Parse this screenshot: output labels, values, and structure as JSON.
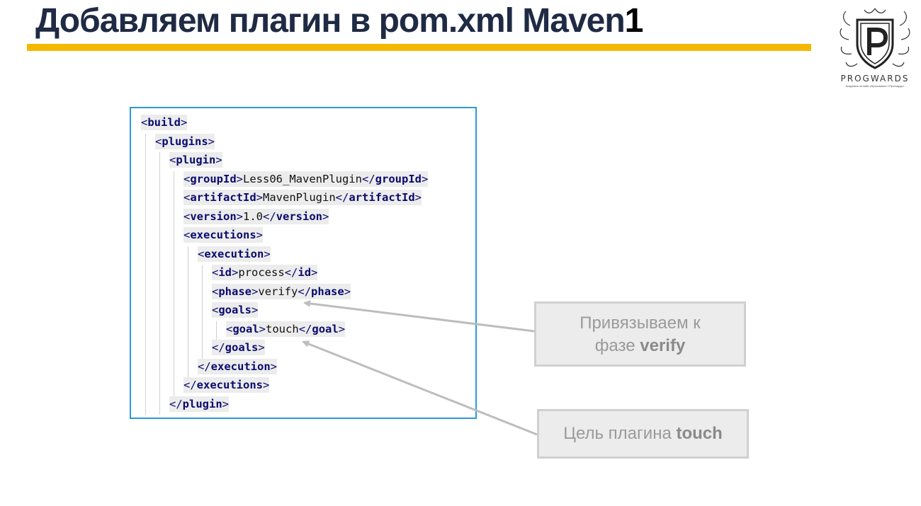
{
  "slide": {
    "title": "Добавляем плагин в pom.xml Maven",
    "title_suffix": "1",
    "accent_color": "#f5b800",
    "title_color": "#1f2a44"
  },
  "logo": {
    "icon": "progwards-crest-icon",
    "name": "PROGWARDS",
    "tagline": "Академия онлайн-образования «Прогвардс»"
  },
  "code": {
    "border_color": "#2a9ad6",
    "lines": [
      {
        "open": "build"
      },
      {
        "open": "plugins"
      },
      {
        "open": "plugin"
      },
      {
        "open": "groupId",
        "text": "Less06_MavenPlugin",
        "close": "groupId"
      },
      {
        "open": "artifactId",
        "text": "MavenPlugin",
        "close": "artifactId"
      },
      {
        "open": "version",
        "text": "1.0",
        "close": "version"
      },
      {
        "open": "executions"
      },
      {
        "open": "execution"
      },
      {
        "open": "id",
        "text": "process",
        "close": "id"
      },
      {
        "open": "phase",
        "text": "verify",
        "close": "phase"
      },
      {
        "open": "goals"
      },
      {
        "open": "goal",
        "text": "touch",
        "close": "goal"
      },
      {
        "close": "goals"
      },
      {
        "close": "execution"
      },
      {
        "close": "executions"
      },
      {
        "close": "plugin"
      }
    ]
  },
  "callouts": {
    "phase_line1": "Привязываем к",
    "phase_line2_prefix": "фазе ",
    "phase_line2_bold": "verify",
    "goal_prefix": "Цель плагина ",
    "goal_bold": "touch"
  }
}
